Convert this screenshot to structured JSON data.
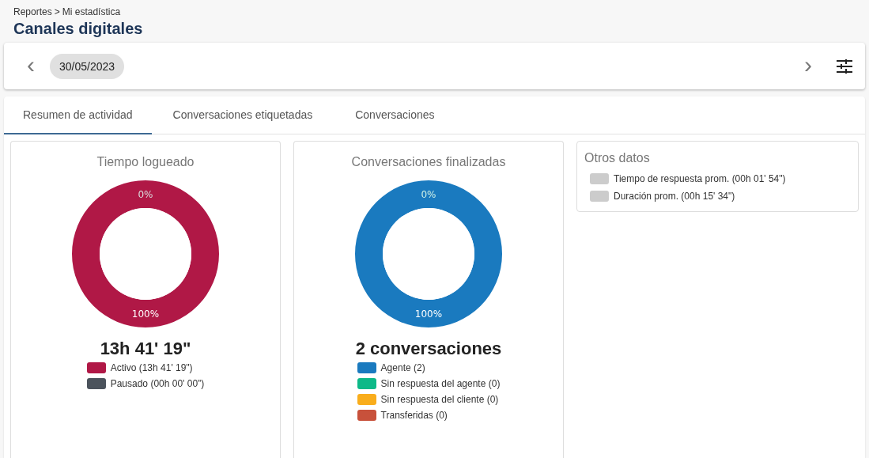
{
  "breadcrumb": {
    "parent": "Reportes",
    "separator": ">",
    "current": "Mi estadística"
  },
  "page_title": "Canales digitales",
  "date_bar": {
    "previous": "‹",
    "date": "30/05/2023",
    "next": "›"
  },
  "tabs": [
    {
      "label": "Resumen de actividad",
      "selected": true
    },
    {
      "label": "Conversaciones etiquetadas",
      "selected": false
    },
    {
      "label": "Conversaciones",
      "selected": false
    }
  ],
  "charts": [
    {
      "title": "Tiempo logueado",
      "total": "13h 41' 19\"",
      "chart_data": {
        "type": "donut",
        "categories": [
          "Activo",
          "Pausado"
        ],
        "values": [
          100,
          0
        ],
        "value_labels": [
          "100%",
          "0%"
        ]
      },
      "legend": [
        {
          "value": "(13h 41' 19\")",
          "color": "#b01846"
        },
        {
          "value": "(00h 00' 00\")",
          "color": "#4b535c"
        }
      ]
    },
    {
      "title": "Conversaciones finalizadas",
      "total": "2 conversaciones",
      "chart_data": {
        "type": "donut",
        "categories": [
          "Agente",
          "Sin respuesta del agente",
          "Sin respuesta del cliente",
          "Transferidas"
        ],
        "values": [
          100,
          0,
          0,
          0
        ],
        "value_labels": [
          "100%",
          "0%",
          null,
          null
        ]
      },
      "legend": [
        {
          "value": "(2)",
          "color": "#1a7abf"
        },
        {
          "value": "(0)",
          "color": "#0db988"
        },
        {
          "value": "(0)",
          "color": "#f9ad1c"
        },
        {
          "value": "(0)",
          "color": "#c8513b"
        }
      ]
    }
  ],
  "other_data": {
    "title": "Otros datos",
    "items": [
      "Tiempo de respuesta prom. (00h 01' 54\")",
      "Duración prom. (00h 15' 34\")"
    ]
  }
}
